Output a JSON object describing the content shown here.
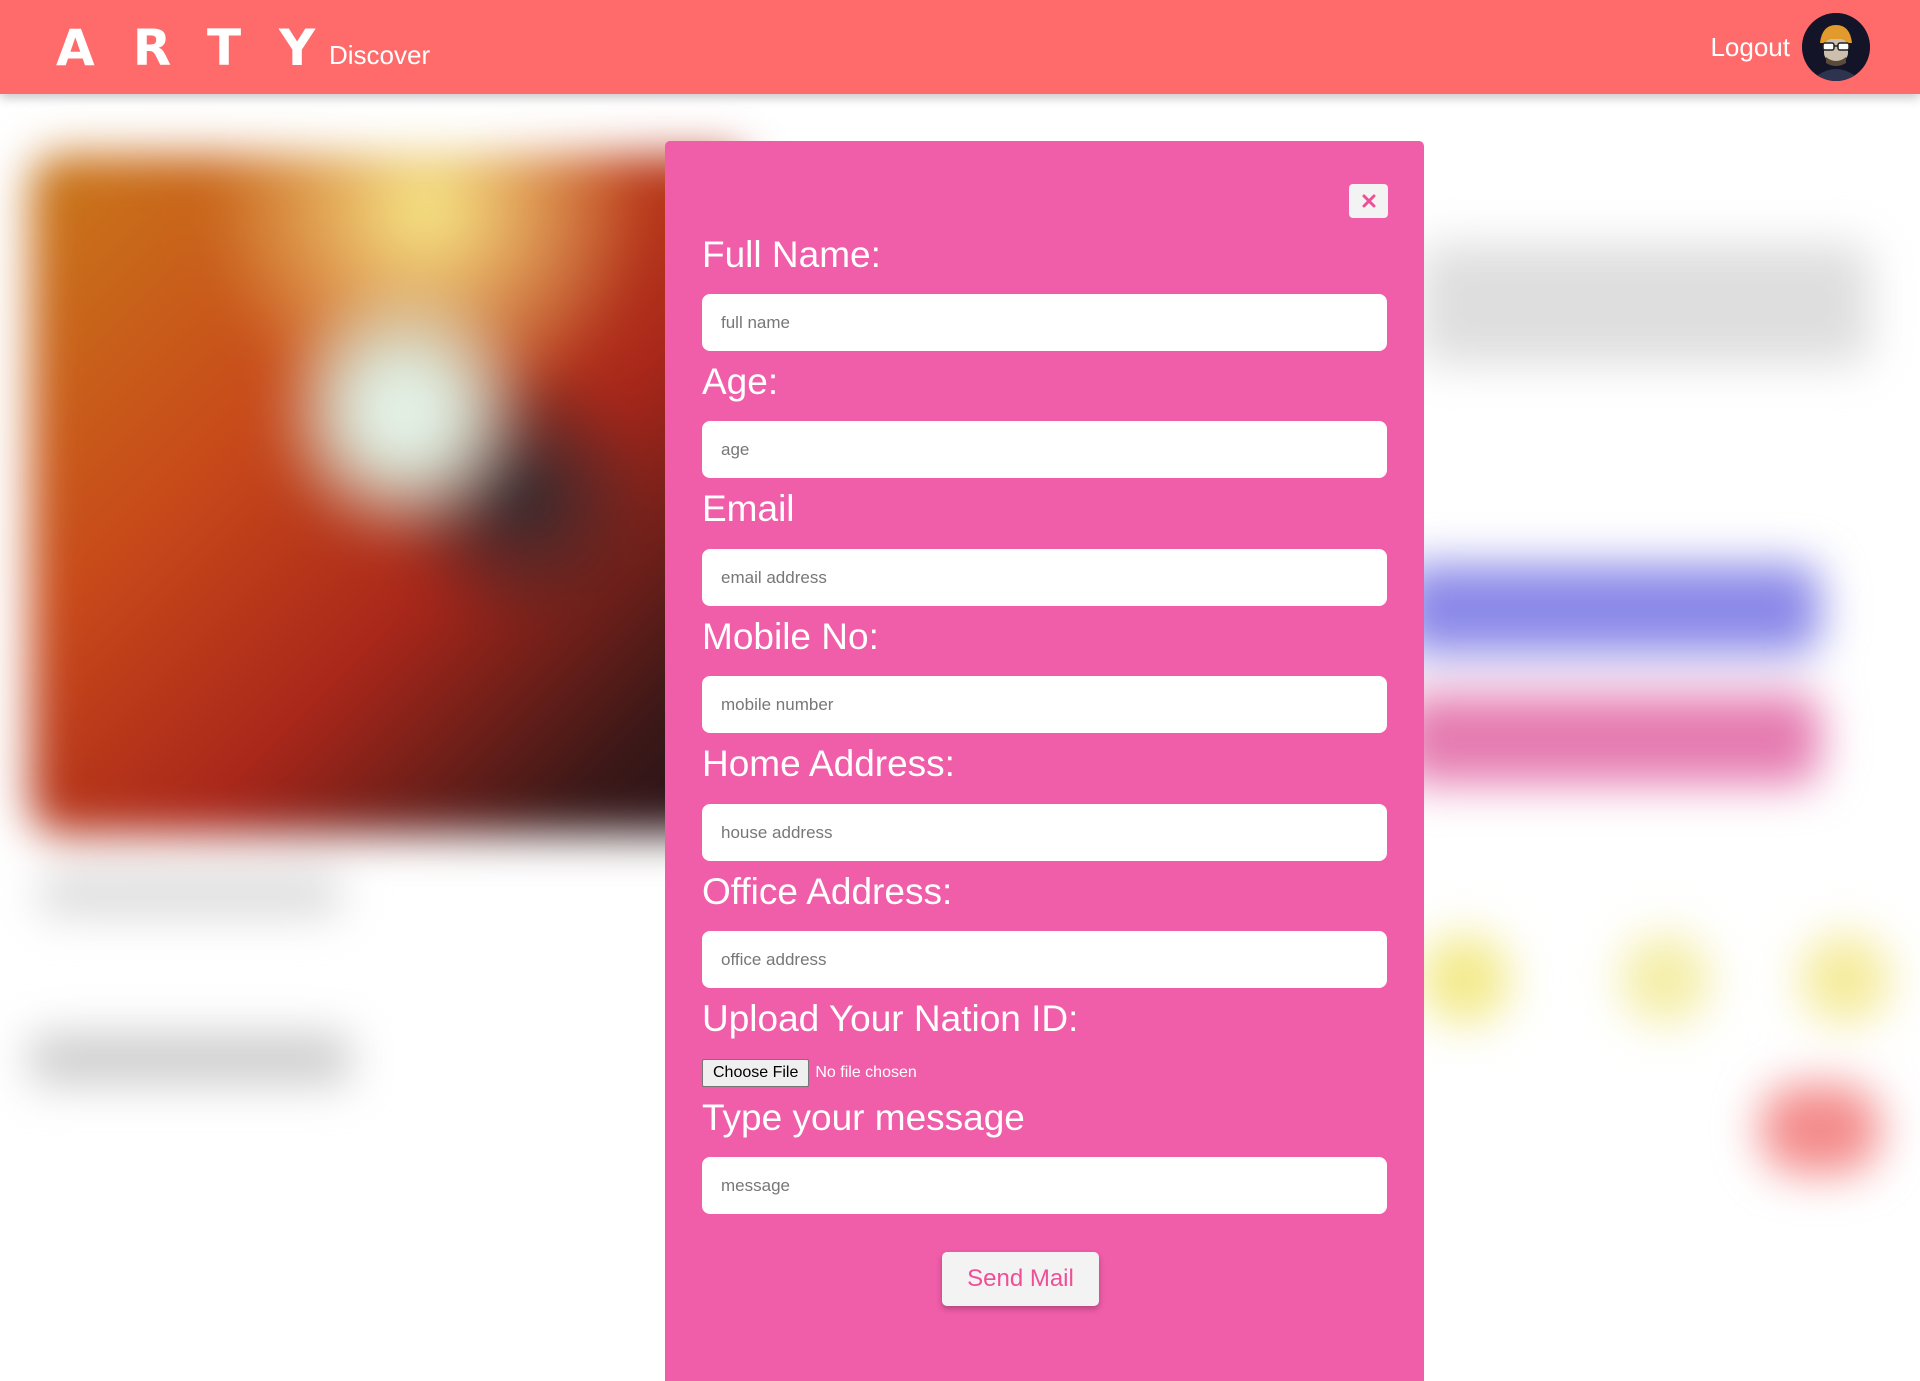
{
  "navbar": {
    "brand": "ARTY",
    "discover": "Discover",
    "logout": "Logout"
  },
  "modal": {
    "fields": [
      {
        "label": "Full Name:",
        "placeholder": "full name"
      },
      {
        "label": "Age:",
        "placeholder": "age"
      },
      {
        "label": "Email",
        "placeholder": "email address"
      },
      {
        "label": "Mobile No:",
        "placeholder": "mobile number"
      },
      {
        "label": "Home Address:",
        "placeholder": "house address"
      },
      {
        "label": "Office Address:",
        "placeholder": "office address"
      }
    ],
    "upload": {
      "label": "Upload Your Nation ID:",
      "button": "Choose File",
      "status": "No file chosen"
    },
    "message": {
      "label": "Type your message",
      "placeholder": "message"
    },
    "send": "Send Mail"
  },
  "colors": {
    "navbar": "#ff6b6b",
    "modal": "#f05da9",
    "accent": "#ef4f96"
  },
  "icons": {
    "close": "close-icon",
    "avatar": "avatar-icon"
  }
}
